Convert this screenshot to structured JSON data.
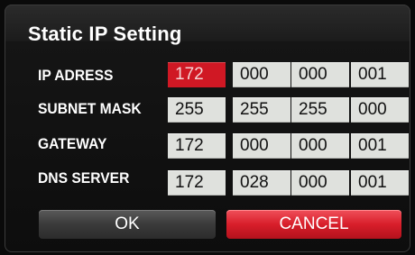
{
  "dialog": {
    "title": "Static IP Setting",
    "rows": [
      {
        "label": "IP ADRESS",
        "octets": [
          "172",
          "000",
          "000",
          "001"
        ]
      },
      {
        "label": "SUBNET MASK",
        "octets": [
          "255",
          "255",
          "255",
          "000"
        ]
      },
      {
        "label": "GATEWAY",
        "octets": [
          "172",
          "000",
          "000",
          "001"
        ]
      },
      {
        "label": "DNS SERVER",
        "octets": [
          "172",
          "028",
          "000",
          "001"
        ]
      }
    ],
    "selected_field": "ip-octet-1",
    "ok_label": "OK",
    "cancel_label": "CANCEL"
  },
  "colors": {
    "selected_field": "#d01824",
    "field_bg": "#dfe1dd",
    "cancel_button": "#d81e2a",
    "ok_button": "#3a3a3a"
  }
}
